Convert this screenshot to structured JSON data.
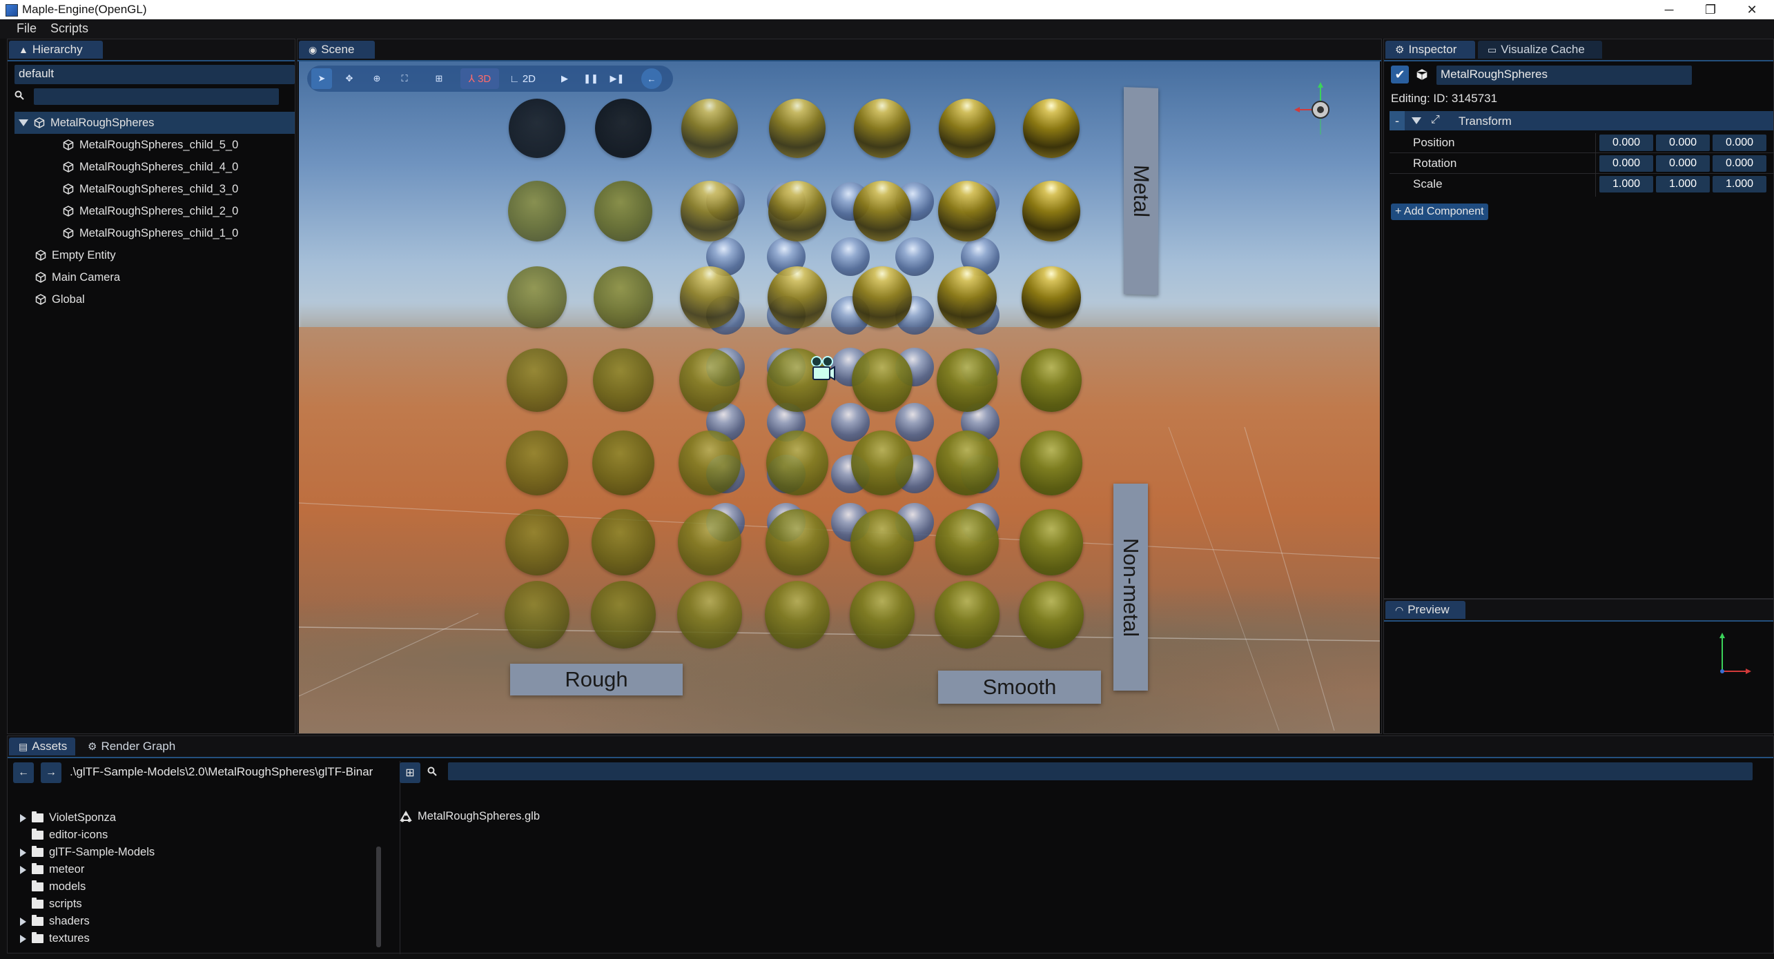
{
  "window": {
    "title": "Maple-Engine(OpenGL)",
    "minimize": "─",
    "restore": "❐",
    "close": "✕"
  },
  "menu": [
    "File",
    "Scripts"
  ],
  "hierarchy": {
    "tab": "Hierarchy",
    "scene_name": "default",
    "search_value": "",
    "items": [
      {
        "label": "MetalRoughSpheres",
        "level": 0,
        "expanded": true,
        "selected": true
      },
      {
        "label": "MetalRoughSpheres_child_5_0",
        "level": 1
      },
      {
        "label": "MetalRoughSpheres_child_4_0",
        "level": 1
      },
      {
        "label": "MetalRoughSpheres_child_3_0",
        "level": 1
      },
      {
        "label": "MetalRoughSpheres_child_2_0",
        "level": 1
      },
      {
        "label": "MetalRoughSpheres_child_1_0",
        "level": 1
      },
      {
        "label": "Empty Entity",
        "level": 0
      },
      {
        "label": "Main Camera",
        "level": 0
      },
      {
        "label": "Global",
        "level": 0
      }
    ]
  },
  "scene": {
    "tab": "Scene",
    "toolbar": {
      "mode3d": "3D",
      "mode2d": "2D"
    },
    "labels": {
      "metal": "Metal",
      "non_metal": "Non-metal",
      "rough": "Rough",
      "smooth": "Smooth"
    }
  },
  "inspector": {
    "tabs": [
      "Inspector",
      "Visualize Cache"
    ],
    "entity_name": "MetalRoughSpheres",
    "editing": "Editing:  ID: 3145731",
    "component": {
      "collapse": "-",
      "name": "Transform"
    },
    "rows": [
      {
        "label": "Position",
        "values": [
          "0.000",
          "0.000",
          "0.000"
        ]
      },
      {
        "label": "Rotation",
        "values": [
          "0.000",
          "0.000",
          "0.000"
        ]
      },
      {
        "label": "Scale",
        "values": [
          "1.000",
          "1.000",
          "1.000"
        ]
      }
    ],
    "add_component": "+ Add Component"
  },
  "preview": {
    "tab": "Preview"
  },
  "assets": {
    "tabs": [
      "Assets",
      "Render Graph"
    ],
    "path": ".\\glTF-Sample-Models\\2.0\\MetalRoughSpheres\\glTF-Binar",
    "search_value": "",
    "folders": [
      {
        "label": "VioletSponza",
        "expandable": true
      },
      {
        "label": "editor-icons",
        "expandable": false
      },
      {
        "label": "glTF-Sample-Models",
        "expandable": true
      },
      {
        "label": "meteor",
        "expandable": true
      },
      {
        "label": "models",
        "expandable": false
      },
      {
        "label": "scripts",
        "expandable": false
      },
      {
        "label": "shaders",
        "expandable": true
      },
      {
        "label": "textures",
        "expandable": true
      }
    ],
    "files": [
      "MetalRoughSpheres.glb"
    ]
  },
  "colors": {
    "accent": "#24507e",
    "tab_active": "#1f3a5f",
    "selection": "#1e3b5c",
    "panel_bg": "#0b0b0c"
  }
}
